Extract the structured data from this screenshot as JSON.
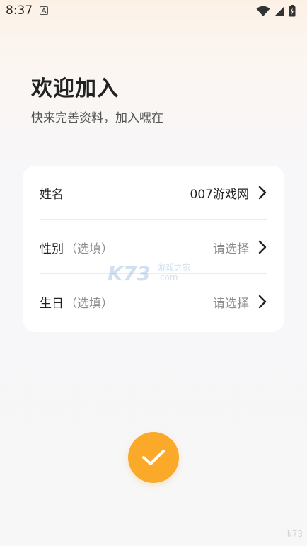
{
  "status_bar": {
    "time": "8:37",
    "notification_icon": "a-notification-icon",
    "icons": [
      "wifi-icon",
      "cellular-signal-icon",
      "battery-charging-icon"
    ]
  },
  "header": {
    "title": "欢迎加入",
    "subtitle": "快来完善资料，加入嘿在"
  },
  "form": {
    "rows": [
      {
        "label": "姓名",
        "hint": "",
        "value": "007游戏网"
      },
      {
        "label": "性别",
        "hint": "（选填）",
        "value": "请选择"
      },
      {
        "label": "生日",
        "hint": "（选填）",
        "value": "请选择"
      }
    ]
  },
  "watermark": {
    "brand": "K73",
    "line1": "游戏之家",
    "line2": ".com"
  },
  "corner_mark": "k73",
  "colors": {
    "accent": "#fba928",
    "card_bg": "#ffffff",
    "placeholder": "#8c8c8c"
  }
}
